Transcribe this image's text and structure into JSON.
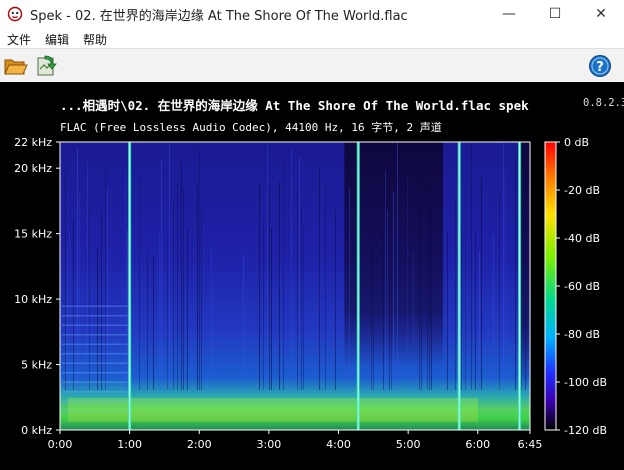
{
  "window": {
    "title": "Spek - 02. 在世界的海岸边缘   At The Shore Of The World.flac",
    "minimize": "—",
    "maximize": "☐",
    "close": "✕"
  },
  "menu": {
    "items": [
      "文件",
      "编辑",
      "帮助"
    ]
  },
  "toolbar": {
    "open_icon": "folder-open-icon",
    "save_icon": "save-image-icon",
    "help_icon": "help-icon",
    "help_glyph": "?"
  },
  "plot": {
    "title": "...相遇时\\02. 在世界的海岸边缘  At The Shore Of The World.flac  spek",
    "version": "0.8.2.3",
    "subtitle": "FLAC (Free Lossless Audio Codec), 44100 Hz, 16 字节, 2 声道",
    "freq_labels": [
      "22 kHz",
      "20 kHz",
      "15 kHz",
      "10 kHz",
      "5 kHz",
      "0 kHz"
    ],
    "time_labels": [
      "0:00",
      "1:00",
      "2:00",
      "3:00",
      "4:00",
      "5:00",
      "6:00",
      "6:45"
    ],
    "db_labels": [
      "0 dB",
      "-20 dB",
      "-40 dB",
      "-60 dB",
      "-80 dB",
      "-100 dB",
      "-120 dB"
    ]
  },
  "colors": {
    "background": "#000000",
    "spectrogram_low": "#10003a",
    "spectrogram_mid": "#1a30c0",
    "spectrogram_high": "#30d070",
    "accent": "#1a73c8"
  }
}
